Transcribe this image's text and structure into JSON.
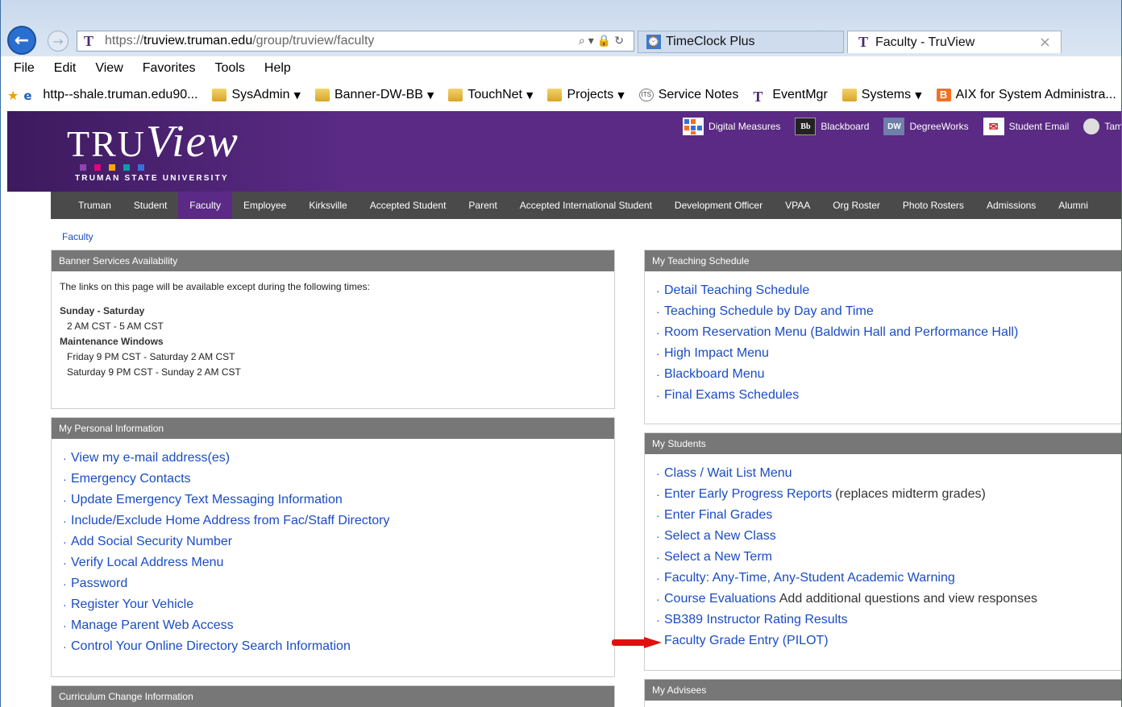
{
  "browser": {
    "address_scheme": "https://",
    "address_host": "truview.truman.edu",
    "address_path": "/group/truview/faculty",
    "address_icons": "⌕▾🔒↻",
    "tabs": [
      {
        "label": "TimeClock Plus",
        "icon": "clock-icon"
      },
      {
        "label": "Faculty - TruView",
        "icon": "truman-t-icon",
        "close": "×"
      }
    ],
    "menu": [
      "File",
      "Edit",
      "View",
      "Favorites",
      "Tools",
      "Help"
    ],
    "favorites": [
      {
        "label": "http--shale.truman.edu90...",
        "icon": "ie-icon"
      },
      {
        "label": "SysAdmin",
        "icon": "folder-icon",
        "dropdown": true
      },
      {
        "label": "Banner-DW-BB",
        "icon": "folder-icon",
        "dropdown": true
      },
      {
        "label": "TouchNet",
        "icon": "folder-icon",
        "dropdown": true
      },
      {
        "label": "Projects",
        "icon": "folder-icon",
        "dropdown": true
      },
      {
        "label": "Service Notes",
        "icon": "its-icon"
      },
      {
        "label": "EventMgr",
        "icon": "truman-t-icon"
      },
      {
        "label": "Systems",
        "icon": "folder-icon",
        "dropdown": true
      },
      {
        "label": "AIX for System Administra...",
        "icon": "blogger-icon"
      }
    ]
  },
  "site": {
    "logo_tru": "TRU",
    "logo_v": "V",
    "logo_iew": "iew",
    "logo_sub": "TRUMAN STATE UNIVERSITY",
    "logo_dot_colors": [
      "#8e44ad",
      "#e5007e",
      "#f7a600",
      "#00a0b0",
      "#3a6fd8"
    ],
    "quicklinks": [
      {
        "label": "Digital Measures",
        "icon": "digital-measures-icon"
      },
      {
        "label": "Blackboard",
        "icon": "blackboard-icon"
      },
      {
        "label": "DegreeWorks",
        "icon": "degreeworks-icon"
      },
      {
        "label": "Student Email",
        "icon": "mail-icon"
      },
      {
        "label": "Tam",
        "icon": "user-icon"
      }
    ],
    "nav": [
      "Truman",
      "Student",
      "Faculty",
      "Employee",
      "Kirksville",
      "Accepted Student",
      "Parent",
      "Accepted International Student",
      "Development Officer",
      "VPAA",
      "Org Roster",
      "Photo Rosters",
      "Admissions",
      "Alumni"
    ],
    "nav_active": "Faculty",
    "breadcrumb": "Faculty",
    "accent": "#5b2a86"
  },
  "panels": {
    "banner_services": {
      "title": "Banner Services Availability",
      "intro": "The links on this page will be available except during the following times:",
      "h1": "Sunday - Saturday",
      "l1": "2 AM CST - 5 AM CST",
      "h2": "Maintenance Windows",
      "l2": "Friday 9 PM CST - Saturday 2 AM CST",
      "l3": "Saturday 9 PM CST - Sunday 2 AM CST"
    },
    "personal_info": {
      "title": "My Personal Information",
      "links": [
        "View my e-mail address(es)",
        "Emergency Contacts",
        "Update Emergency Text Messaging Information",
        "Include/Exclude Home Address from Fac/Staff Directory",
        "Add Social Security Number",
        "Verify Local Address Menu",
        "Password",
        "Register Your Vehicle",
        "Manage Parent Web Access",
        "Control Your Online Directory Search Information"
      ]
    },
    "curriculum": {
      "title": "Curriculum Change Information"
    },
    "teaching": {
      "title": "My Teaching Schedule",
      "links": [
        "Detail Teaching Schedule",
        "Teaching Schedule by Day and Time",
        "Room Reservation Menu (Baldwin Hall and Performance Hall)",
        "High Impact Menu",
        "Blackboard Menu",
        "Final Exams Schedules"
      ]
    },
    "students": {
      "title": "My Students",
      "links": [
        {
          "text": "Class / Wait List Menu",
          "note": ""
        },
        {
          "text": "Enter Early Progress Reports",
          "note": "(replaces midterm grades)"
        },
        {
          "text": "Enter Final Grades",
          "note": ""
        },
        {
          "text": "Select a New Class",
          "note": ""
        },
        {
          "text": "Select a New Term",
          "note": ""
        },
        {
          "text": "Faculty: Any-Time, Any-Student Academic Warning",
          "note": ""
        },
        {
          "text": "Course Evaluations",
          "note": "Add additional questions and view responses"
        },
        {
          "text": "SB389 Instructor Rating Results",
          "note": ""
        },
        {
          "text": "Faculty Grade Entry (PILOT)",
          "note": ""
        }
      ]
    },
    "advisees": {
      "title": "My Advisees"
    }
  }
}
